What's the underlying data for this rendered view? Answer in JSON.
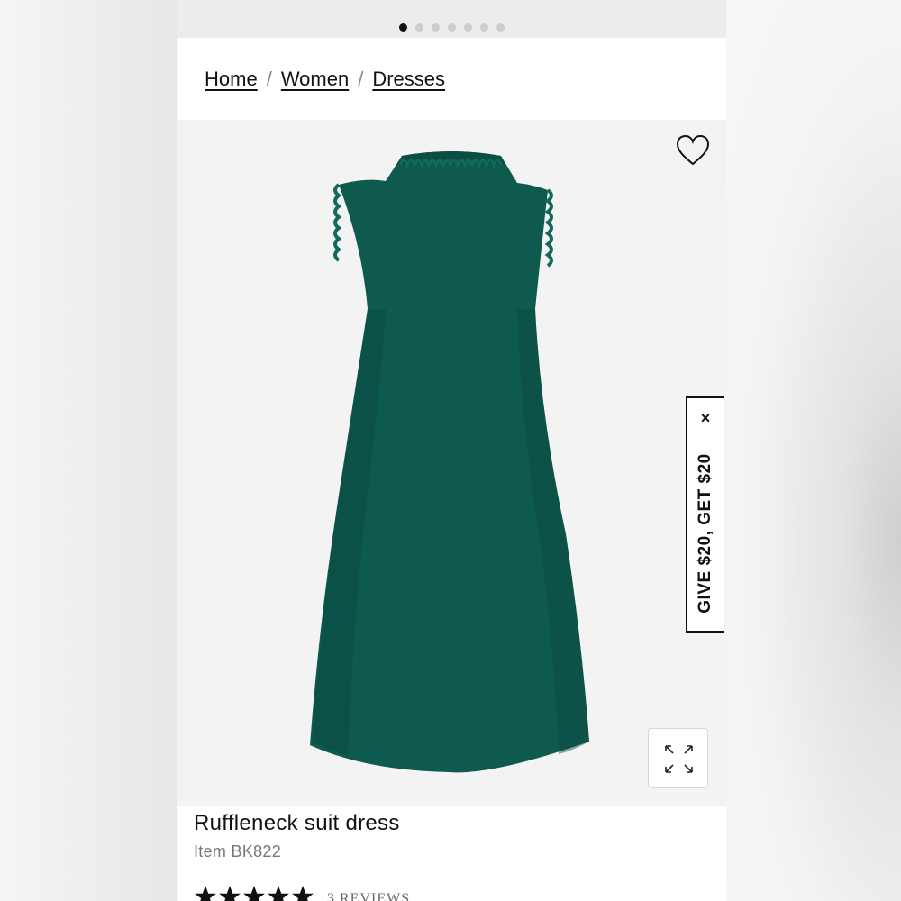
{
  "carousel": {
    "total_slides": 7,
    "active_index": 0
  },
  "breadcrumb": {
    "items": [
      "Home",
      "Women",
      "Dresses"
    ],
    "separator": "/"
  },
  "product_image": {
    "dress_color": "#0e5a4f",
    "background": "#f3f3f3"
  },
  "wishlist": {
    "icon": "heart-icon"
  },
  "promo": {
    "text": "GIVE $20, GET $20",
    "close_glyph": "×"
  },
  "expand": {
    "icon": "expand-icon"
  },
  "product": {
    "title": "Ruffleneck suit dress",
    "item_code": "Item BK822",
    "rating": 5,
    "reviews_text": "3 REVIEWS"
  }
}
